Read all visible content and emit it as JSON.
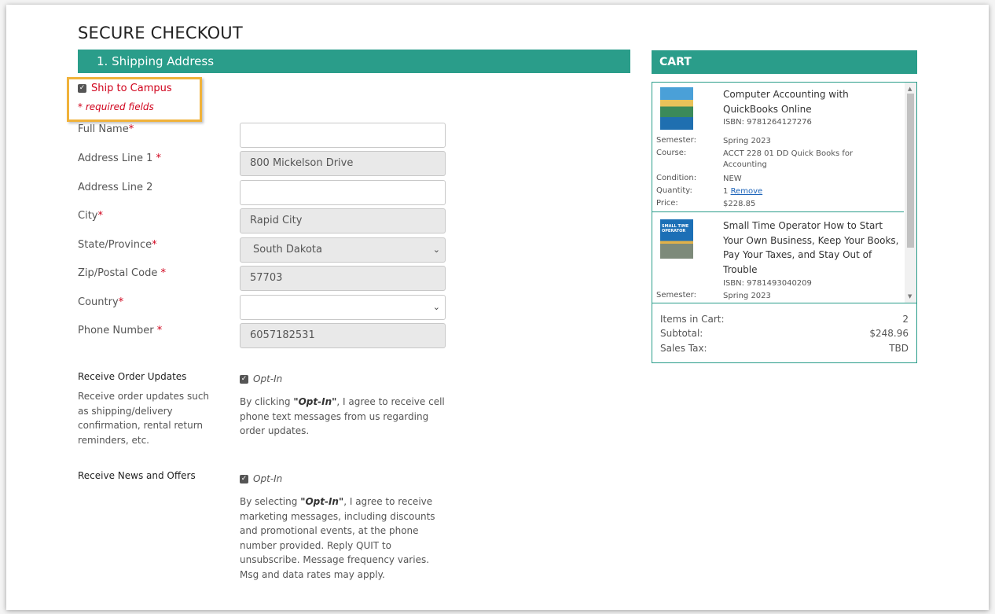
{
  "page_title": "SECURE CHECKOUT",
  "shipping_section": {
    "header": "1. Shipping Address",
    "ship_to_campus_label": "Ship to Campus",
    "required_note": "* required fields"
  },
  "form": {
    "fields": [
      {
        "label": "Full Name",
        "required": "*",
        "value": ""
      },
      {
        "label": "Address Line 1",
        "required": "*",
        "value": "800 Mickelson Drive"
      },
      {
        "label": "Address Line 2",
        "required": "",
        "value": ""
      },
      {
        "label": "City",
        "required": "*",
        "value": "Rapid City"
      },
      {
        "label": "State/Province",
        "required": "*",
        "value": "South Dakota"
      },
      {
        "label": "Zip/Postal Code",
        "required": "*",
        "value": "57703"
      },
      {
        "label": "Country",
        "required": "*",
        "value": ""
      },
      {
        "label": "Phone Number",
        "required": "*",
        "value": "6057182531"
      }
    ]
  },
  "order_updates": {
    "heading": "Receive Order Updates",
    "description": "Receive order updates such as shipping/delivery confirmation, rental return reminders, etc.",
    "optin_label": "Opt-In",
    "consent_prefix": "By clicking ",
    "consent_bold": "\"Opt-In\"",
    "consent_suffix": ", I agree to receive cell phone text messages from us regarding order updates."
  },
  "news_offers": {
    "heading": "Receive News and Offers",
    "optin_label": "Opt-In",
    "consent_prefix": "By selecting ",
    "consent_bold": "\"Opt-In\"",
    "consent_suffix": ", I agree to receive marketing messages, including discounts and promotional events, at the phone number provided. Reply QUIT to unsubscribe. Message frequency varies. Msg and data rates may apply."
  },
  "cart": {
    "header": "CART",
    "items": [
      {
        "title": "Computer Accounting with QuickBooks Online",
        "isbn": "ISBN: 9781264127276",
        "semester_label": "Semester:",
        "semester": "Spring 2023",
        "course_label": "Course:",
        "course": "ACCT 228 01 DD Quick Books for Accounting",
        "condition_label": "Condition:",
        "condition": "NEW",
        "quantity_label": "Quantity:",
        "quantity": "1",
        "remove_label": "Remove",
        "price_label": "Price:",
        "price": "$228.85"
      },
      {
        "title": "Small Time Operator How to Start Your Own Business, Keep Your Books, Pay Your Taxes, and Stay Out of Trouble",
        "isbn": "ISBN: 9781493040209",
        "semester_label": "Semester:",
        "semester": "Spring 2023",
        "cover_text": "SMALL TIME OPERATOR"
      }
    ],
    "totals": {
      "items_label": "Items in Cart:",
      "items_value": "2",
      "subtotal_label": "Subtotal:",
      "subtotal_value": "$248.96",
      "tax_label": "Sales Tax:",
      "tax_value": "TBD"
    }
  },
  "colors": {
    "accent": "#2a9d8a",
    "required": "#d0021b",
    "highlight": "#f0b23a"
  }
}
